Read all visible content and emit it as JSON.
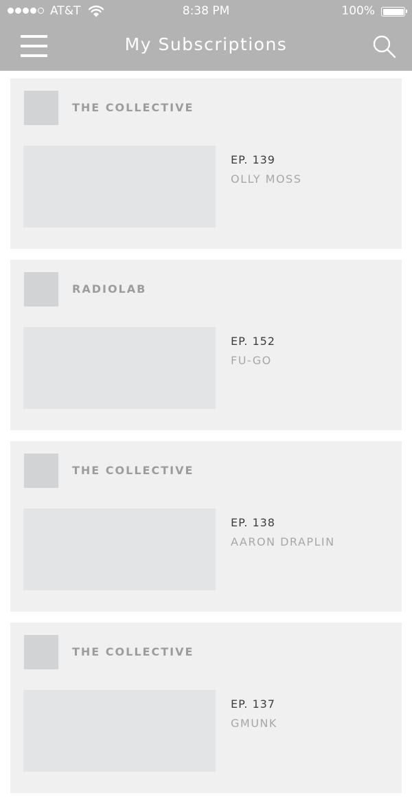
{
  "status_bar": {
    "carrier": "AT&T",
    "time": "8:38 PM",
    "battery": "100%",
    "signal_icon": "signal-dots-icon",
    "wifi_icon": "wifi-icon",
    "battery_icon": "battery-icon"
  },
  "nav": {
    "title": "My Subscriptions",
    "menu_icon": "hamburger-menu-icon",
    "search_icon": "search-icon"
  },
  "colors": {
    "header_bg": "#b3b3b3",
    "card_bg": "#f0f0f0",
    "placeholder": "#d2d3d5"
  },
  "feed": [
    {
      "podcast": "THE COLLECTIVE",
      "episode_number": "EP. 139",
      "episode_title": "OLLY MOSS"
    },
    {
      "podcast": "RADIOLAB",
      "episode_number": "EP. 152",
      "episode_title": "FU-GO"
    },
    {
      "podcast": "THE COLLECTIVE",
      "episode_number": "EP. 138",
      "episode_title": "AARON DRAPLIN"
    },
    {
      "podcast": "THE COLLECTIVE",
      "episode_number": "EP. 137",
      "episode_title": "GMUNK"
    }
  ]
}
